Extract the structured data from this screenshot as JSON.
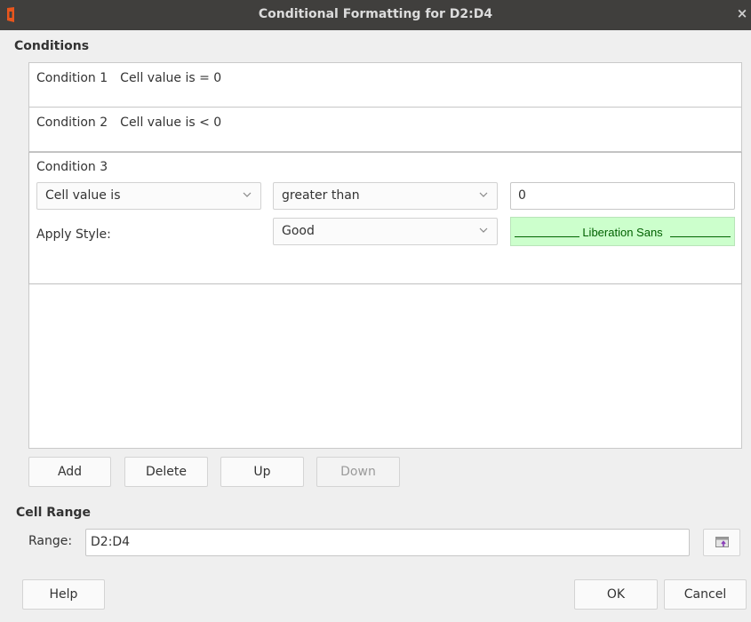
{
  "window": {
    "title": "Conditional Formatting for D2:D4",
    "close_glyph": "×",
    "app_icon": "office-icon"
  },
  "conditions_section": {
    "label": "Conditions",
    "items": [
      {
        "label": "Condition 1",
        "summary": "Cell value is = 0"
      },
      {
        "label": "Condition 2",
        "summary": "Cell value is < 0"
      },
      {
        "label": "Condition 3",
        "type_select": "Cell value is",
        "operator_select": "greater than",
        "value": "0",
        "apply_style_label": "Apply Style:",
        "style_select": "Good",
        "preview_text": "Liberation Sans",
        "preview_bg": "#ccffcc",
        "preview_fg": "#006100"
      }
    ]
  },
  "buttons": {
    "add": "Add",
    "delete": "Delete",
    "up": "Up",
    "down": "Down",
    "help": "Help",
    "ok": "OK",
    "cancel": "Cancel"
  },
  "cell_range_section": {
    "label": "Cell Range",
    "range_label": "Range:",
    "range_value": "D2:D4",
    "shrink_icon": "shrink-dialog-icon"
  }
}
